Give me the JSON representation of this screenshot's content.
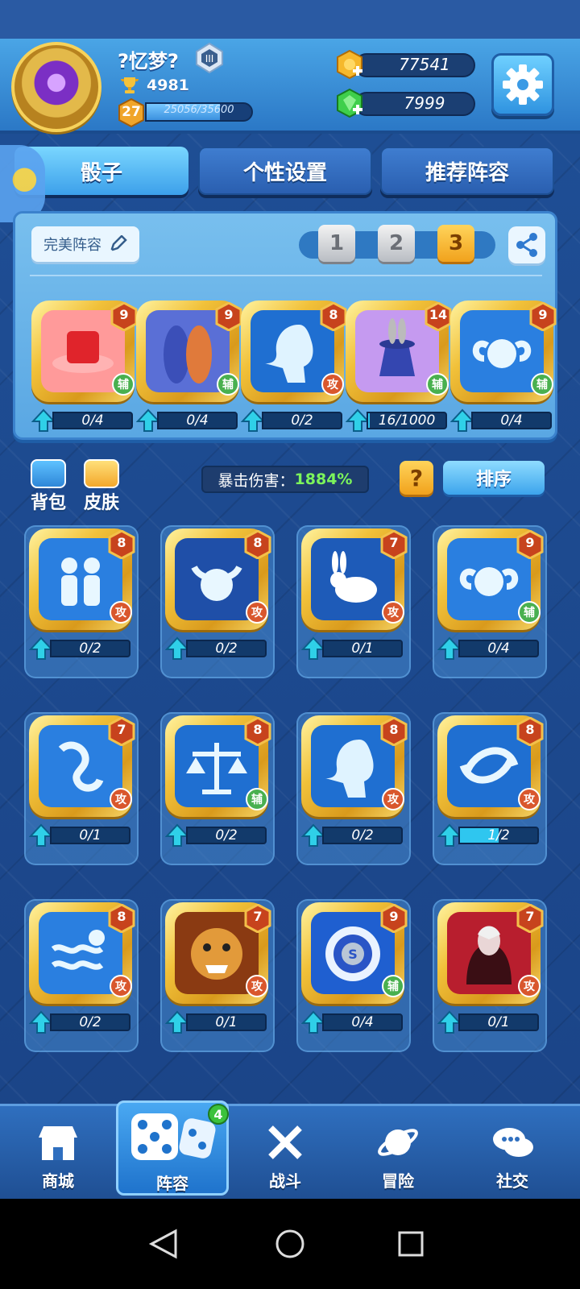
{
  "player": {
    "name": "?忆梦?",
    "trophies": "4981",
    "level": "27",
    "xp_text": "25056/35600",
    "xp_fraction": 0.7038
  },
  "currency": {
    "gold": "77541",
    "gems": "7999"
  },
  "tabs": [
    {
      "label": "骰子"
    },
    {
      "label": "个性设置"
    },
    {
      "label": "推荐阵容"
    }
  ],
  "deck": {
    "name_label": "完美阵容",
    "slots": [
      "1",
      "2",
      "3"
    ],
    "active_slot": 3,
    "dice": [
      {
        "level": "9",
        "role": "辅",
        "progress_text": "0/4",
        "progress": 0,
        "icon": "red-hat-icon",
        "color": "#ff9a9a"
      },
      {
        "level": "9",
        "role": "辅",
        "progress_text": "0/4",
        "progress": 0,
        "icon": "gemini-figures-icon",
        "color": "#5a6fd6"
      },
      {
        "level": "8",
        "role": "攻",
        "progress_text": "0/2",
        "progress": 0,
        "icon": "virgo-icon",
        "color": "#1f6fd1"
      },
      {
        "level": "14",
        "role": "辅",
        "progress_text": "16/1000",
        "progress": 0.016,
        "icon": "magic-hat-rabbit-icon",
        "color": "#c59af0"
      },
      {
        "level": "9",
        "role": "辅",
        "progress_text": "0/4",
        "progress": 0,
        "icon": "aries-icon",
        "color": "#2a7fe0"
      }
    ]
  },
  "controls": {
    "bag_label": "背包",
    "skin_label": "皮肤",
    "crit_label": "暴击伤害：",
    "crit_value": "1884%",
    "help_label": "?",
    "sort_label": "排序"
  },
  "collection": [
    {
      "level": "8",
      "role": "攻",
      "progress_text": "0/2",
      "progress": 0,
      "icon": "gemini-icon",
      "color": "#2a7fe0"
    },
    {
      "level": "8",
      "role": "攻",
      "progress_text": "0/2",
      "progress": 0,
      "icon": "taurus-icon",
      "color": "#1f4fa8"
    },
    {
      "level": "7",
      "role": "攻",
      "progress_text": "0/1",
      "progress": 0,
      "icon": "rabbit-icon",
      "color": "#1e5bb8"
    },
    {
      "level": "9",
      "role": "辅",
      "progress_text": "0/4",
      "progress": 0,
      "icon": "aries-icon",
      "color": "#2a7fe0"
    },
    {
      "level": "7",
      "role": "攻",
      "progress_text": "0/1",
      "progress": 0,
      "icon": "capricorn-icon",
      "color": "#2a7fe0"
    },
    {
      "level": "8",
      "role": "辅",
      "progress_text": "0/2",
      "progress": 0,
      "icon": "libra-icon",
      "color": "#1f6fd1"
    },
    {
      "level": "8",
      "role": "攻",
      "progress_text": "0/2",
      "progress": 0,
      "icon": "virgo-icon",
      "color": "#1f6fd1"
    },
    {
      "level": "8",
      "role": "攻",
      "progress_text": "1/2",
      "progress": 0.5,
      "icon": "pisces-icon",
      "color": "#1f6fd1"
    },
    {
      "level": "8",
      "role": "攻",
      "progress_text": "0/2",
      "progress": 0,
      "icon": "aquarius-icon",
      "color": "#2a7fe0"
    },
    {
      "level": "7",
      "role": "攻",
      "progress_text": "0/1",
      "progress": 0,
      "icon": "tiger-icon",
      "color": "#8a3a12"
    },
    {
      "level": "9",
      "role": "辅",
      "progress_text": "0/4",
      "progress": 0,
      "icon": "target-s-icon",
      "color": "#1f5fd0"
    },
    {
      "level": "7",
      "role": "攻",
      "progress_text": "0/1",
      "progress": 0,
      "icon": "vampire-icon",
      "color": "#b81e2e"
    }
  ],
  "nav": [
    {
      "label": "商城",
      "icon": "shop-icon"
    },
    {
      "label": "阵容",
      "icon": "dice-icon",
      "badge": "4"
    },
    {
      "label": "战斗",
      "icon": "crossed-swords-icon"
    },
    {
      "label": "冒险",
      "icon": "planet-icon"
    },
    {
      "label": "社交",
      "icon": "chat-bubbles-icon"
    }
  ]
}
